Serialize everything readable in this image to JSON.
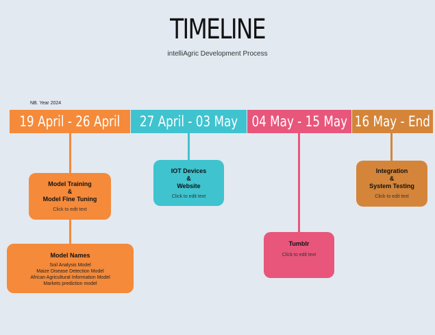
{
  "title": "TIMELINE",
  "subtitle": "intelliAgric Development Process",
  "note": "NB. Year 2024",
  "phases": [
    {
      "label": "19 April - 26 April",
      "color": "#f58a3a"
    },
    {
      "label": "27 April - 03 May",
      "color": "#3fc3cf"
    },
    {
      "label": "04 May - 15 May",
      "color": "#e8567c"
    },
    {
      "label": "16 May - End",
      "color": "#d4853a"
    }
  ],
  "cards": {
    "model_training": {
      "line1": "Model Training",
      "line2": "&",
      "line3": "Model Fine Tuning",
      "sub": "Click to edit text"
    },
    "model_names": {
      "title": "Model Names",
      "items": [
        "Soil Analysis Model",
        "Maize Disease Detection Model",
        "African Agricultural Information Model",
        "Markets prediction model"
      ]
    },
    "iot": {
      "line1": "IOT Devices",
      "line2": "&",
      "line3": "Website",
      "sub": "Click to edit text"
    },
    "tumblr": {
      "title": "Tumblr",
      "sub": "Click to edit text"
    },
    "integration": {
      "line1": "Integration",
      "line2": "&",
      "line3": "System Testing",
      "sub": "Click to edit text"
    }
  }
}
